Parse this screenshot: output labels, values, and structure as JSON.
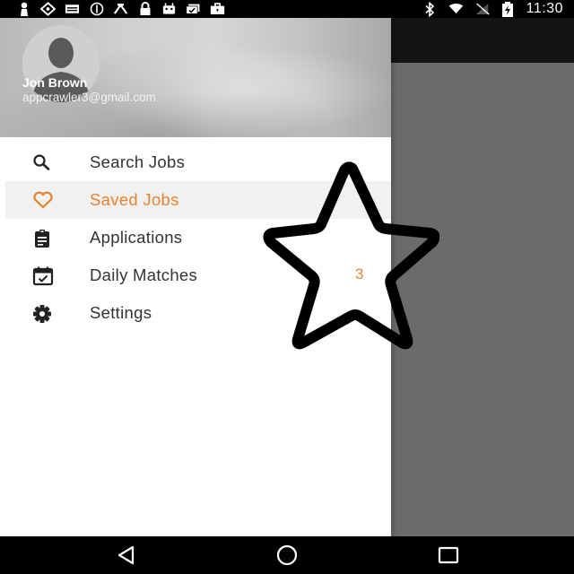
{
  "status_bar": {
    "time": "11:30",
    "left_icons": [
      "person-icon",
      "location-icon",
      "storage-icon",
      "block-icon",
      "fax-icon",
      "lock-icon",
      "android-icon",
      "photo-check-icon",
      "briefcase-icon"
    ],
    "right_icons": [
      "bluetooth-icon",
      "wifi-icon",
      "no-signal-icon",
      "battery-charging-icon"
    ]
  },
  "drawer": {
    "user": {
      "name": "Jon Brown",
      "email": "appcrawler3@gmail.com"
    },
    "items": [
      {
        "label": "Search Jobs",
        "icon": "search-icon",
        "active": false,
        "badge": ""
      },
      {
        "label": "Saved Jobs",
        "icon": "heart-icon",
        "active": true,
        "badge": ""
      },
      {
        "label": "Applications",
        "icon": "clipboard-icon",
        "active": false,
        "badge": ""
      },
      {
        "label": "Daily Matches",
        "icon": "calendar-check-icon",
        "active": false,
        "badge": "3"
      },
      {
        "label": "Settings",
        "icon": "gear-icon",
        "active": false,
        "badge": ""
      }
    ]
  },
  "colors": {
    "accent": "#e8822f",
    "scrim": "#6b6b6b",
    "app_bar": "#141414"
  },
  "nav_bar": {
    "buttons": [
      "back-icon",
      "home-icon",
      "recents-icon"
    ]
  }
}
